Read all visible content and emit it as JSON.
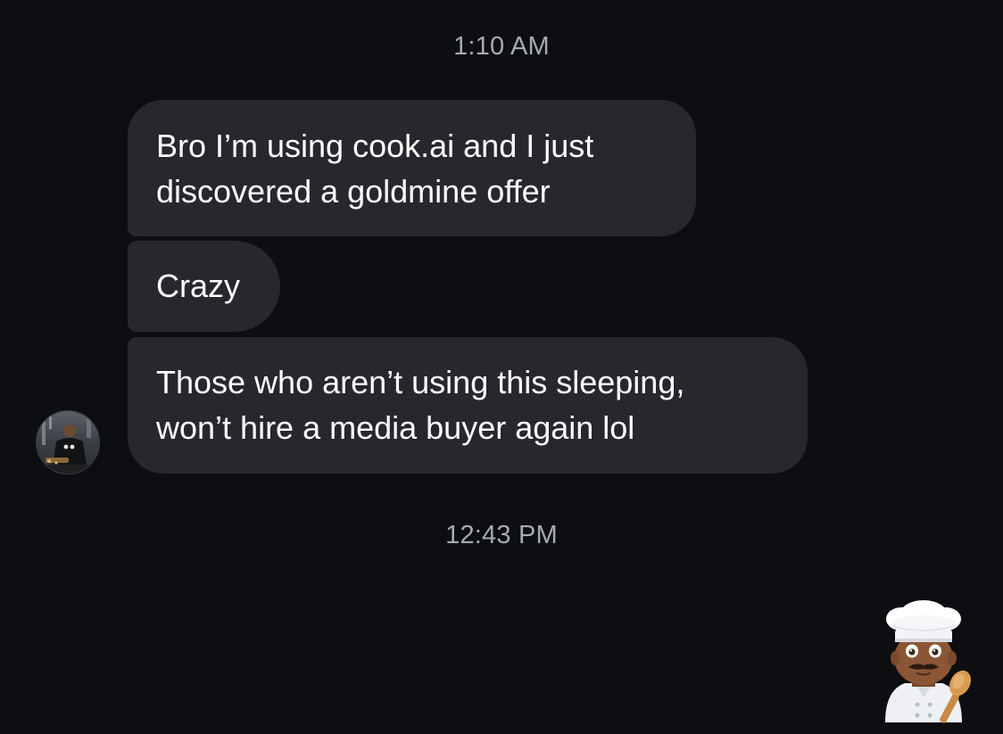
{
  "thread": {
    "timestamp_1": "1:10 AM",
    "messages": [
      {
        "lines": [
          "Bro I’m using cook.ai and I just",
          "discovered a goldmine offer"
        ]
      },
      {
        "lines": [
          "Crazy"
        ]
      },
      {
        "lines": [
          "Those who aren’t using this sleeping,",
          "won’t hire a media buyer again lol"
        ]
      }
    ],
    "timestamp_2": "12:43 PM",
    "sender_avatar_icon": "user-photo-avatar",
    "reply_emoji_icon": "cook-emoji-icon"
  },
  "colors": {
    "background": "#0c0e11",
    "bubble": "#26282d",
    "timestamp_text": "#a7aab0",
    "message_text": "#ffffff"
  }
}
